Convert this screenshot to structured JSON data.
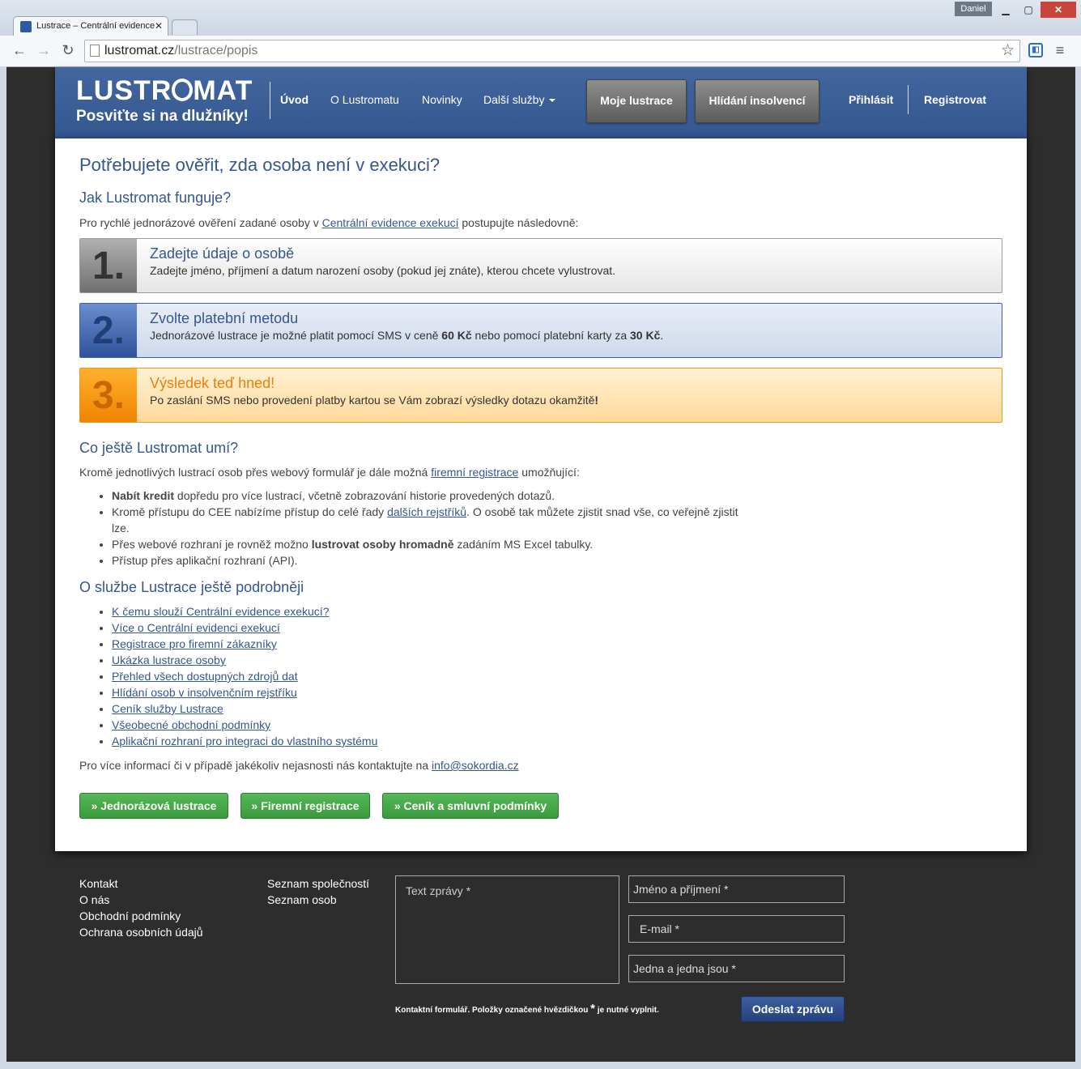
{
  "browser": {
    "tab_title": "Lustrace – Centrální evidence exekucí",
    "user": "Daniel",
    "url_host": "lustromat.cz",
    "url_path": "/lustrace/popis"
  },
  "header": {
    "logo_left": "LUSTR",
    "logo_right": "MAT",
    "slogan": "Posviťte si na dlužníky!",
    "nav": [
      "Úvod",
      "O Lustromatu",
      "Novinky",
      "Další služby"
    ],
    "btn_lustrace": "Moje lustrace",
    "btn_insolvence": "Hlídání insolvencí",
    "login": "Přihlásit",
    "register": "Registrovat"
  },
  "content": {
    "title": "Potřebujete ověřit, zda osoba není v exekuci?",
    "how_title": "Jak Lustromat funguje?",
    "intro_before": "Pro rychlé jednorázové ověření zadané osoby v ",
    "intro_link": "Centrální evidence exekucí",
    "intro_after": " postupujte následovně:",
    "steps": [
      {
        "num": "1.",
        "title": "Zadejte údaje o osobě",
        "desc": "Zadejte jméno, příjmení a datum narození osoby (pokud jej znáte), kterou chcete vylustrovat."
      },
      {
        "num": "2.",
        "title": "Zvolte platební metodu",
        "desc_a": "Jednorázové lustrace je možné platit pomocí SMS v ceně ",
        "price_sms": "60 Kč",
        "desc_b": " nebo pomocí platební karty za ",
        "price_card": "30 Kč",
        "desc_c": "."
      },
      {
        "num": "3.",
        "title": "Výsledek teď hned!",
        "desc": "Po zaslání SMS nebo provedení platby kartou se Vám zobrazí výsledky dotazu okamžitě",
        "desc_end": "!"
      }
    ],
    "more_title": "Co ještě Lustromat umí?",
    "more_before": "Kromě jednotlivých lustrací osob přes webový formulář je dále možná ",
    "more_link": "firemní registrace",
    "more_after": " umožňující:",
    "bullets": {
      "b1_bold": "Nabít kredit",
      "b1_rest": " dopředu pro více lustrací, včetně zobrazování historie provedených dotazů.",
      "b2_a": "Kromě přístupu do CEE nabízíme přístup do celé řady ",
      "b2_link": "dalších rejstříků",
      "b2_b": ". O osobě tak můžete zjistit snad vše, co veřejně zjistit lze.",
      "b3_a": "Přes webové rozhraní je rovněž možno ",
      "b3_bold": "lustrovat osoby hromadně",
      "b3_b": " zadáním MS Excel tabulky.",
      "b4": "Přístup přes aplikační rozhraní (API)."
    },
    "details_title": "O službe Lustrace ještě podrobněji",
    "details_links": [
      "K čemu slouží Centrální evidence exekucí?",
      "Více o Centrální evidenci exekucí",
      "Registrace pro firemní zákazníky",
      "Ukázka lustrace osoby",
      "Přehled všech dostupných zdrojů dat",
      "Hlídání osob v insolvenčním rejstříku",
      "Ceník služby Lustrace",
      "Všeobecné obchodní podmínky",
      "Aplikační rozhraní pro integraci do vlastního systému"
    ],
    "contact_before": "Pro více informací či v případě jakékoliv nejasnosti nás kontaktujte na ",
    "contact_email": "info@sokordia.cz",
    "buttons": [
      "» Jednorázová lustrace",
      "» Firemní registrace",
      "» Ceník a smluvní podmínky"
    ]
  },
  "footer": {
    "col1": [
      "Kontakt",
      "O nás",
      "Obchodní podmínky",
      "Ochrana osobních údajů"
    ],
    "col2": [
      "Seznam společností",
      "Seznam osob"
    ],
    "message_placeholder": "Text zprávy *",
    "name_placeholder": "Jméno a příjmení *",
    "email_placeholder": "E-mail *",
    "captcha_placeholder": "Jedna a jedna jsou *",
    "note_before": "Kontaktní formulář. Položky označené hvězdičkou ",
    "note_star": "*",
    "note_after": " je nutné vyplnit.",
    "send": "Odeslat zprávu"
  }
}
